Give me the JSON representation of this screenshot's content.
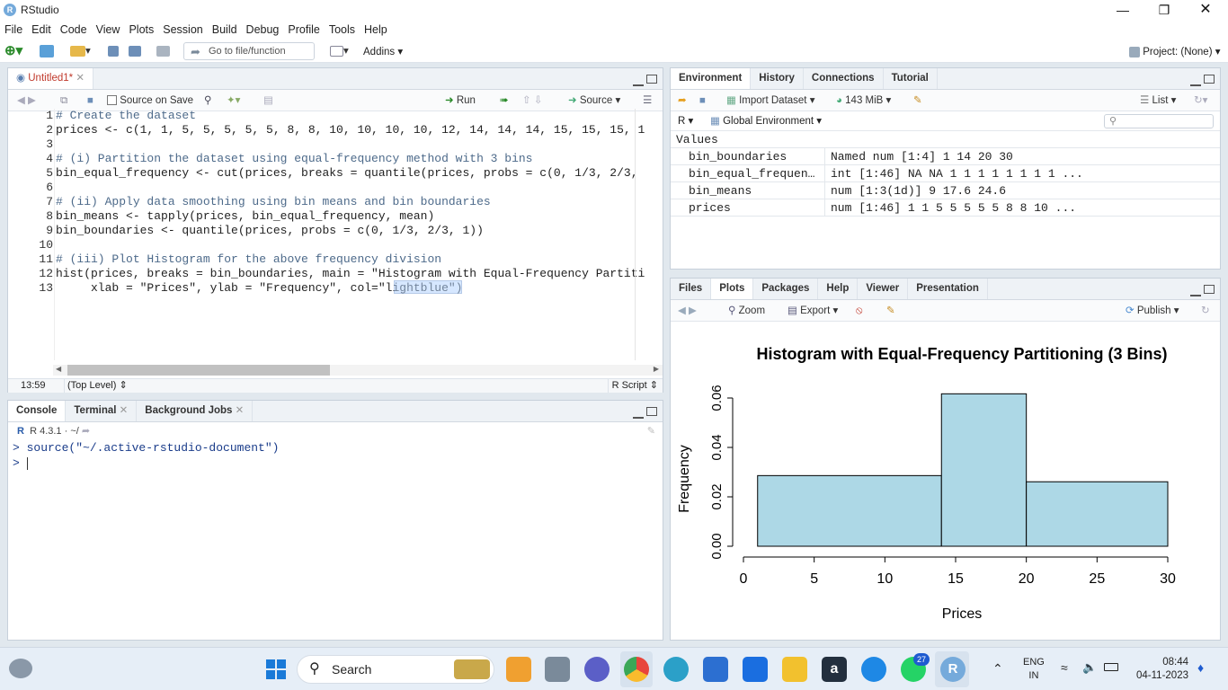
{
  "window": {
    "title": "RStudio",
    "logo": "R"
  },
  "menu": [
    "File",
    "Edit",
    "Code",
    "View",
    "Plots",
    "Session",
    "Build",
    "Debug",
    "Profile",
    "Tools",
    "Help"
  ],
  "toolbar": {
    "goto_placeholder": "Go to file/function",
    "addins": "Addins",
    "project": "Project: (None)"
  },
  "editor": {
    "tab": "Untitled1*",
    "source_on_save": "Source on Save",
    "run": "Run",
    "source": "Source",
    "lines": [
      "# Create the dataset",
      "prices <- c(1, 1, 5, 5, 5, 5, 5, 8, 8, 10, 10, 10, 10, 12, 14, 14, 14, 15, 15, 15, 1",
      "",
      "# (i) Partition the dataset using equal-frequency method with 3 bins",
      "bin_equal_frequency <- cut(prices, breaks = quantile(prices, probs = c(0, 1/3, 2/3,",
      "",
      "# (ii) Apply data smoothing using bin means and bin boundaries",
      "bin_means <- tapply(prices, bin_equal_frequency, mean)",
      "bin_boundaries <- quantile(prices, probs = c(0, 1/3, 2/3, 1))",
      "",
      "# (iii) Plot Histogram for the above frequency division",
      "hist(prices, breaks = bin_boundaries, main = \"Histogram with Equal-Frequency Partiti",
      "     xlab = \"Prices\", ylab = \"Frequency\", col=\"lightblue\")"
    ],
    "line_numbers": [
      "1",
      "2",
      "3",
      "4",
      "5",
      "6",
      "7",
      "8",
      "9",
      "10",
      "11",
      "12",
      "13"
    ],
    "status_pos": "13:59",
    "status_scope": "(Top Level)",
    "status_type": "R Script"
  },
  "console": {
    "tabs": [
      "Console",
      "Terminal",
      "Background Jobs"
    ],
    "version": "R 4.3.1 · ~/",
    "line1": "> source(\"~/.active-rstudio-document\")",
    "prompt": "> "
  },
  "environment": {
    "tabs": [
      "Environment",
      "History",
      "Connections",
      "Tutorial"
    ],
    "import_dataset": "Import Dataset",
    "memory": "143 MiB",
    "list": "List",
    "r_label": "R",
    "global_env": "Global Environment",
    "section": "Values",
    "rows": [
      {
        "name": "bin_boundaries",
        "value": "Named num [1:4] 1 14 20 30"
      },
      {
        "name": "bin_equal_frequen…",
        "value": "int [1:46] NA NA 1 1 1 1 1 1 1 1 ..."
      },
      {
        "name": "bin_means",
        "value": "num [1:3(1d)] 9 17.6 24.6"
      },
      {
        "name": "prices",
        "value": "num [1:46] 1 1 5 5 5 5 5 8 8 10 ..."
      }
    ]
  },
  "plots_pane": {
    "tabs": [
      "Files",
      "Plots",
      "Packages",
      "Help",
      "Viewer",
      "Presentation"
    ],
    "zoom": "Zoom",
    "export": "Export",
    "publish": "Publish"
  },
  "chart_data": {
    "type": "bar",
    "title": "Histogram with Equal-Frequency Partitioning (3 Bins)",
    "xlabel": "Prices",
    "ylabel": "Frequency",
    "bins": [
      {
        "from": 1,
        "to": 14,
        "density": 0.0286
      },
      {
        "from": 14,
        "to": 20,
        "density": 0.0617
      },
      {
        "from": 20,
        "to": 30,
        "density": 0.0261
      }
    ],
    "xticks": [
      "0",
      "5",
      "10",
      "15",
      "20",
      "25",
      "30"
    ],
    "yticks": [
      "0.00",
      "0.02",
      "0.04",
      "0.06"
    ],
    "xlim": [
      0,
      30
    ],
    "ylim": [
      0,
      0.06
    ],
    "fill": "#add8e6"
  },
  "taskbar": {
    "search": "Search",
    "lang1": "ENG",
    "lang2": "IN",
    "time": "08:44",
    "date": "04-11-2023",
    "badge": "27"
  }
}
